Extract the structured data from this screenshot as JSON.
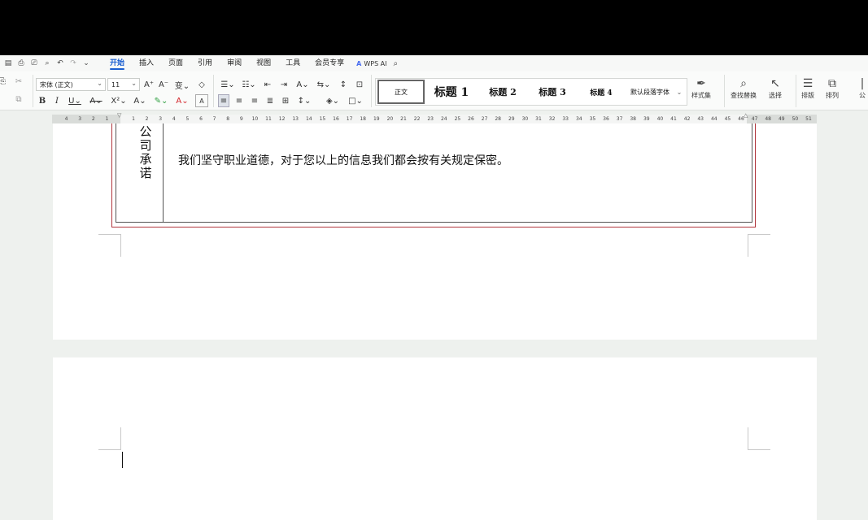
{
  "menu": {
    "tabs": [
      "开始",
      "插入",
      "页面",
      "引用",
      "审阅",
      "视图",
      "工具",
      "会员专享"
    ],
    "active_tab": "开始",
    "wps_ai": "WPS AI"
  },
  "ribbon": {
    "font_name": "宋体 (正文)",
    "font_size": "11",
    "styles": [
      "正文",
      "标题 1",
      "标题 2",
      "标题 3",
      "标题 4",
      "默认段落字体"
    ],
    "styles_set_label": "样式集",
    "find_replace_label": "查找替换",
    "select_label": "选择",
    "arrange_label": "排版",
    "order_label": "排列",
    "partial_label": "公"
  },
  "ruler": {
    "left_numbers": [
      "4",
      "3",
      "2",
      "1"
    ],
    "right_numbers": [
      "1",
      "2",
      "3",
      "4",
      "5",
      "6",
      "7",
      "8",
      "9",
      "10",
      "11",
      "12",
      "13",
      "14",
      "15",
      "16",
      "17",
      "18",
      "19",
      "20",
      "21",
      "22",
      "23",
      "24",
      "25",
      "26",
      "27",
      "28",
      "29",
      "30",
      "31",
      "32",
      "33",
      "34",
      "35",
      "36",
      "37",
      "38",
      "39",
      "40",
      "41",
      "42",
      "43",
      "44",
      "45",
      "46",
      "47",
      "48",
      "49",
      "50",
      "51"
    ]
  },
  "document": {
    "vertical_label": "公司承诺",
    "commitment_text": "我们坚守职业道德，对于您以上的信息我们都会按有关规定保密。"
  },
  "colors": {
    "accent": "#1a5fd1",
    "frame_border": "#b0343c"
  }
}
